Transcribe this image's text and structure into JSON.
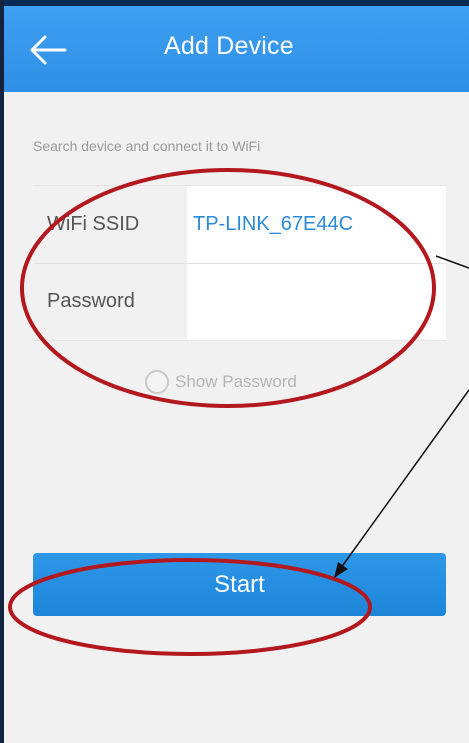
{
  "header": {
    "title": "Add Device",
    "back_icon": "arrow-left-icon"
  },
  "subtitle": "Search device and connect it to WiFi",
  "form": {
    "ssid_label": "WiFi SSID",
    "ssid_value": "TP-LINK_67E44C",
    "password_label": "Password",
    "password_value": "",
    "password_placeholder": ""
  },
  "show_password": {
    "label": "Show Password",
    "checked": false
  },
  "start_button": {
    "label": "Start"
  },
  "colors": {
    "appbar": "#2f8fe6",
    "accent": "#2b8ad8",
    "annotation": "#b3181e"
  }
}
